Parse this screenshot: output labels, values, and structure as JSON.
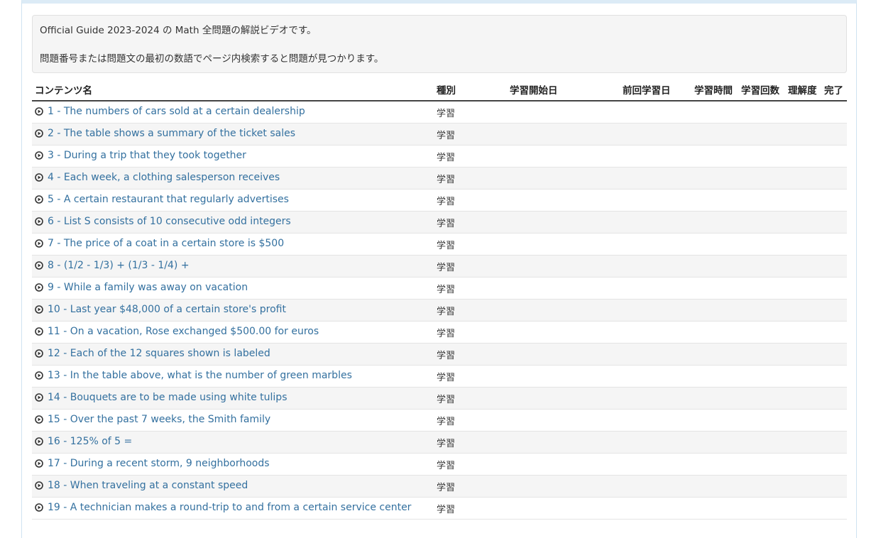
{
  "notice": {
    "line1": "Official Guide 2023-2024 の Math 全問題の解説ビデオです。",
    "line2": "問題番号または問題文の最初の数語でページ内検索すると問題が見つかります。"
  },
  "table": {
    "headers": {
      "content": "コンテンツ名",
      "kind": "種別",
      "start_date": "学習開始日",
      "last_date": "前回学習日",
      "study_time": "学習時間",
      "study_count": "学習回数",
      "understanding": "理解度",
      "done": "完了"
    },
    "rows": [
      {
        "title": "1 - The numbers of cars sold at a certain dealership",
        "kind": "学習"
      },
      {
        "title": "2 - The table shows a summary of the ticket sales",
        "kind": "学習"
      },
      {
        "title": "3 - During a trip that they took together",
        "kind": "学習"
      },
      {
        "title": "4 - Each week, a clothing salesperson receives",
        "kind": "学習"
      },
      {
        "title": "5 - A certain restaurant that regularly advertises",
        "kind": "学習"
      },
      {
        "title": "6 - List S consists of 10 consecutive odd integers",
        "kind": "学習"
      },
      {
        "title": "7 - The price of a coat in a certain store is $500",
        "kind": "学習"
      },
      {
        "title": "8 - (1/2 - 1/3) + (1/3 - 1/4) +",
        "kind": "学習"
      },
      {
        "title": "9 - While a family was away on vacation",
        "kind": "学習"
      },
      {
        "title": "10 - Last year $48,000 of a certain store's profit",
        "kind": "学習"
      },
      {
        "title": "11 - On a vacation, Rose exchanged $500.00 for euros",
        "kind": "学習"
      },
      {
        "title": "12 - Each of the 12 squares shown is labeled",
        "kind": "学習"
      },
      {
        "title": "13 - In the table above, what is the number of green marbles",
        "kind": "学習"
      },
      {
        "title": "14 - Bouquets are to be made using white tulips",
        "kind": "学習"
      },
      {
        "title": "15 - Over the past 7 weeks, the Smith family",
        "kind": "学習"
      },
      {
        "title": "16 - 125% of 5 =",
        "kind": "学習"
      },
      {
        "title": "17 - During a recent storm, 9 neighborhoods",
        "kind": "学習"
      },
      {
        "title": "18 - When traveling at a constant speed",
        "kind": "学習"
      },
      {
        "title": "19 - A technician makes a round-trip to and from a certain service center",
        "kind": "学習"
      }
    ]
  },
  "icons": {
    "row_icon": "play-circle-icon"
  },
  "colors": {
    "link": "#33709f",
    "stripe": "#f5f5f5",
    "panel_border": "#cfe3f1"
  }
}
